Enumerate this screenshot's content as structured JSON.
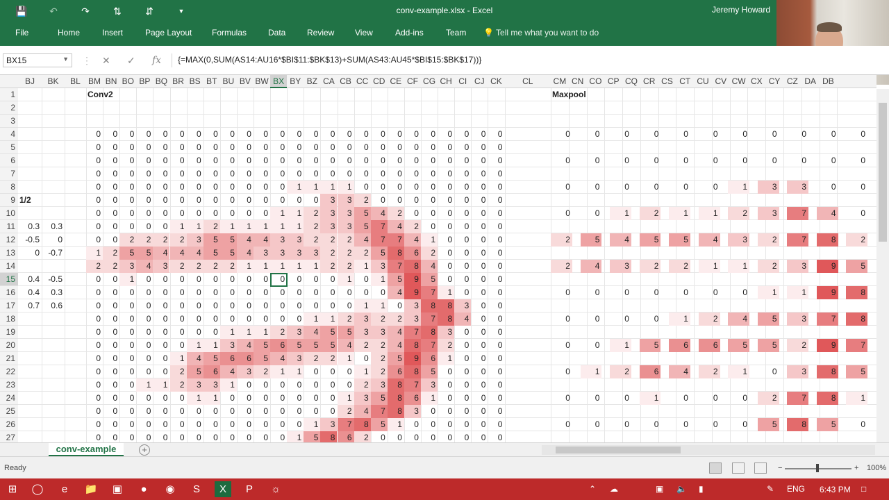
{
  "window": {
    "title": "conv-example.xlsx  -  Excel",
    "user": "Jeremy Howard"
  },
  "qat": {
    "save_icon": "save-icon",
    "undo_icon": "undo-icon",
    "redo_icon": "redo-icon",
    "sort_asc_icon": "sort-ascending-icon",
    "sort_desc_icon": "sort-descending-icon",
    "customize_icon": "customize-qat-icon"
  },
  "ribbon": {
    "tabs": [
      "File",
      "Home",
      "Insert",
      "Page Layout",
      "Formulas",
      "Data",
      "Review",
      "View",
      "Add-ins",
      "Team"
    ],
    "tell_me": "Tell me what you want to do"
  },
  "formula_bar": {
    "name_box": "BX15",
    "formula": "{=MAX(0,SUM(AS14:AU16*$BI$11:$BK$13)+SUM(AS43:AU45*$BI$15:$BK$17))}"
  },
  "columns_left": [
    "BJ",
    "BK",
    "BL"
  ],
  "columns_conv": [
    "BM",
    "BN",
    "BO",
    "BP",
    "BQ",
    "BR",
    "BS",
    "BT",
    "BU",
    "BV",
    "BW",
    "BX",
    "BY",
    "BZ",
    "CA",
    "CB",
    "CC",
    "CD",
    "CE",
    "CF",
    "CG",
    "CH",
    "CI",
    "CJ",
    "CK"
  ],
  "columns_mid": [
    "CL"
  ],
  "columns_pool": [
    "CM",
    "CN",
    "CO",
    "CP",
    "CQ",
    "CR",
    "CS",
    "CT",
    "CU",
    "CV",
    "CW",
    "CX",
    "CY",
    "CZ",
    "DA",
    "DB"
  ],
  "selected_column": "BX",
  "selected_row": 15,
  "row_numbers": [
    1,
    2,
    3,
    4,
    5,
    6,
    7,
    8,
    9,
    10,
    11,
    12,
    13,
    14,
    15,
    16,
    17,
    18,
    19,
    20,
    21,
    22,
    23,
    24,
    25,
    26,
    27
  ],
  "labels": {
    "conv2": "Conv2",
    "maxpool": "Maxpool",
    "half": "1/2"
  },
  "weights": [
    {
      "row": 11,
      "values": [
        "0.3",
        "0.3"
      ]
    },
    {
      "row": 12,
      "values": [
        "-0.5",
        "0"
      ]
    },
    {
      "row": 13,
      "values": [
        "0",
        "-0.7"
      ]
    },
    {
      "row": 15,
      "values": [
        "0.4",
        "-0.5"
      ]
    },
    {
      "row": 16,
      "values": [
        "0.4",
        "0.3"
      ]
    },
    {
      "row": 17,
      "values": [
        "0.7",
        "0.6"
      ]
    }
  ],
  "conv2": [
    [
      0,
      0,
      0,
      0,
      0,
      0,
      0,
      0,
      0,
      0,
      0,
      0,
      0,
      0,
      0,
      0,
      0,
      0,
      0,
      0,
      0,
      0,
      0,
      0,
      0
    ],
    [
      0,
      0,
      0,
      0,
      0,
      0,
      0,
      0,
      0,
      0,
      0,
      0,
      0,
      0,
      0,
      0,
      0,
      0,
      0,
      0,
      0,
      0,
      0,
      0,
      0
    ],
    [
      0,
      0,
      0,
      0,
      0,
      0,
      0,
      0,
      0,
      0,
      0,
      0,
      0,
      0,
      0,
      0,
      0,
      0,
      0,
      0,
      0,
      0,
      0,
      0,
      0
    ],
    [
      0,
      0,
      0,
      0,
      0,
      0,
      0,
      0,
      0,
      0,
      0,
      0,
      0,
      0,
      0,
      0,
      0,
      0,
      0,
      0,
      0,
      0,
      0,
      0,
      0
    ],
    [
      0,
      0,
      0,
      0,
      0,
      0,
      0,
      0,
      0,
      0,
      0,
      0,
      1,
      1,
      1,
      1,
      0,
      0,
      0,
      0,
      0,
      0,
      0,
      0,
      0
    ],
    [
      0,
      0,
      0,
      0,
      0,
      0,
      0,
      0,
      0,
      0,
      0,
      0,
      0,
      0,
      3,
      3,
      2,
      0,
      0,
      0,
      0,
      0,
      0,
      0,
      0
    ],
    [
      0,
      0,
      0,
      0,
      0,
      0,
      0,
      0,
      0,
      0,
      0,
      1,
      1,
      2,
      3,
      3,
      5,
      4,
      2,
      0,
      0,
      0,
      0,
      0,
      0
    ],
    [
      0,
      0,
      0,
      0,
      0,
      1,
      1,
      2,
      1,
      1,
      1,
      1,
      1,
      2,
      3,
      3,
      5,
      7,
      4,
      2,
      0,
      0,
      0,
      0,
      0
    ],
    [
      0,
      0,
      2,
      2,
      2,
      2,
      3,
      5,
      5,
      4,
      4,
      3,
      3,
      2,
      2,
      2,
      4,
      7,
      7,
      4,
      1,
      0,
      0,
      0,
      0
    ],
    [
      1,
      2,
      5,
      5,
      4,
      4,
      4,
      5,
      5,
      4,
      3,
      3,
      3,
      3,
      2,
      2,
      2,
      5,
      8,
      6,
      2,
      0,
      0,
      0,
      0
    ],
    [
      2,
      2,
      3,
      4,
      3,
      2,
      2,
      2,
      2,
      1,
      1,
      1,
      1,
      1,
      2,
      2,
      1,
      3,
      7,
      8,
      4,
      0,
      0,
      0,
      0
    ],
    [
      0,
      0,
      1,
      0,
      0,
      0,
      0,
      0,
      0,
      0,
      0,
      0,
      0,
      0,
      0,
      1,
      0,
      1,
      5,
      9,
      5,
      0,
      0,
      0,
      0
    ],
    [
      0,
      0,
      0,
      0,
      0,
      0,
      0,
      0,
      0,
      0,
      0,
      0,
      0,
      0,
      0,
      0,
      0,
      0,
      4,
      9,
      7,
      1,
      0,
      0,
      0
    ],
    [
      0,
      0,
      0,
      0,
      0,
      0,
      0,
      0,
      0,
      0,
      0,
      0,
      0,
      0,
      0,
      0,
      1,
      1,
      0,
      3,
      8,
      8,
      3,
      0,
      0
    ],
    [
      0,
      0,
      0,
      0,
      0,
      0,
      0,
      0,
      0,
      0,
      0,
      0,
      0,
      1,
      1,
      2,
      3,
      2,
      2,
      3,
      7,
      8,
      4,
      0,
      0
    ],
    [
      0,
      0,
      0,
      0,
      0,
      0,
      0,
      0,
      1,
      1,
      1,
      2,
      3,
      4,
      5,
      5,
      3,
      3,
      4,
      7,
      8,
      3,
      0,
      0,
      0
    ],
    [
      0,
      0,
      0,
      0,
      0,
      0,
      1,
      1,
      3,
      4,
      5,
      6,
      5,
      5,
      5,
      4,
      2,
      2,
      4,
      8,
      7,
      2,
      0,
      0,
      0
    ],
    [
      0,
      0,
      0,
      0,
      0,
      1,
      4,
      5,
      6,
      6,
      5,
      4,
      3,
      2,
      2,
      1,
      0,
      2,
      5,
      9,
      6,
      1,
      0,
      0,
      0
    ],
    [
      0,
      0,
      0,
      0,
      0,
      2,
      5,
      6,
      4,
      3,
      2,
      1,
      1,
      0,
      0,
      0,
      1,
      2,
      6,
      8,
      5,
      0,
      0,
      0,
      0
    ],
    [
      0,
      0,
      0,
      1,
      1,
      2,
      3,
      3,
      1,
      0,
      0,
      0,
      0,
      0,
      0,
      0,
      2,
      3,
      8,
      7,
      3,
      0,
      0,
      0,
      0
    ],
    [
      0,
      0,
      0,
      0,
      0,
      0,
      1,
      1,
      0,
      0,
      0,
      0,
      0,
      0,
      0,
      1,
      3,
      5,
      8,
      6,
      1,
      0,
      0,
      0,
      0
    ],
    [
      0,
      0,
      0,
      0,
      0,
      0,
      0,
      0,
      0,
      0,
      0,
      0,
      0,
      0,
      0,
      2,
      4,
      7,
      8,
      3,
      0,
      0,
      0,
      0,
      0
    ],
    [
      0,
      0,
      0,
      0,
      0,
      0,
      0,
      0,
      0,
      0,
      0,
      0,
      0,
      1,
      3,
      7,
      8,
      5,
      1,
      0,
      0,
      0,
      0,
      0,
      0
    ],
    [
      0,
      0,
      0,
      0,
      0,
      0,
      0,
      0,
      0,
      0,
      0,
      0,
      1,
      5,
      8,
      6,
      2,
      0,
      0,
      0,
      0,
      0,
      0,
      0,
      0
    ]
  ],
  "maxpool": [
    {
      "row": 4,
      "values": [
        0,
        0,
        0,
        0,
        0,
        0,
        0,
        0,
        0,
        0,
        0
      ]
    },
    {
      "row": 6,
      "values": [
        0,
        0,
        0,
        0,
        0,
        0,
        0,
        0,
        0,
        0,
        0
      ]
    },
    {
      "row": 8,
      "values": [
        0,
        0,
        0,
        0,
        0,
        0,
        1,
        3,
        3,
        0,
        0
      ]
    },
    {
      "row": 10,
      "values": [
        0,
        0,
        1,
        2,
        1,
        1,
        2,
        3,
        7,
        4,
        0
      ]
    },
    {
      "row": 12,
      "values": [
        2,
        5,
        4,
        5,
        5,
        4,
        3,
        2,
        7,
        8,
        2
      ]
    },
    {
      "row": 14,
      "values": [
        2,
        4,
        3,
        2,
        2,
        1,
        1,
        2,
        3,
        9,
        5
      ]
    },
    {
      "row": 16,
      "values": [
        0,
        0,
        0,
        0,
        0,
        0,
        0,
        1,
        1,
        9,
        8
      ]
    },
    {
      "row": 18,
      "values": [
        0,
        0,
        0,
        0,
        1,
        2,
        4,
        5,
        3,
        7,
        8
      ]
    },
    {
      "row": 20,
      "values": [
        0,
        0,
        1,
        5,
        6,
        6,
        5,
        5,
        2,
        9,
        7
      ]
    },
    {
      "row": 22,
      "values": [
        0,
        1,
        2,
        6,
        4,
        2,
        1,
        0,
        3,
        8,
        5
      ]
    },
    {
      "row": 24,
      "values": [
        0,
        0,
        0,
        1,
        0,
        0,
        0,
        2,
        7,
        8,
        1
      ]
    },
    {
      "row": 26,
      "values": [
        0,
        0,
        0,
        0,
        0,
        0,
        0,
        5,
        8,
        5,
        0
      ]
    }
  ],
  "sheet_tab": "conv-example",
  "status": {
    "ready": "Ready",
    "zoom": "100%"
  },
  "taskbar": {
    "language": "ENG",
    "time": "6:43 PM"
  },
  "colors": {
    "accent": "#217346",
    "heat_max": "#e0585a",
    "taskbar": "#bd2a2a"
  }
}
